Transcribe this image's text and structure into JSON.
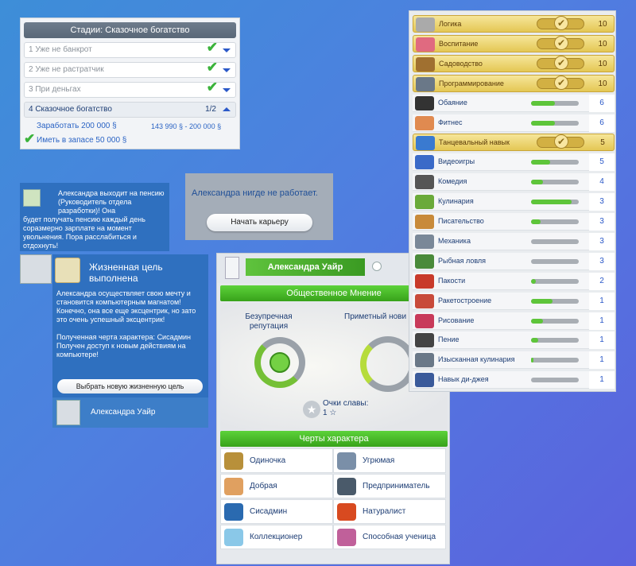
{
  "stages": {
    "header": "Стадии: Сказочное богатство",
    "rows": [
      {
        "label": "1 Уже не банкрот",
        "done": true
      },
      {
        "label": "2 Уже не растратчик",
        "done": true
      },
      {
        "label": "3 При деньгах",
        "done": true
      }
    ],
    "active": {
      "label": "4 Сказочное богатство",
      "count": "1/2"
    },
    "goal1": "Заработать 200 000 §",
    "goal1_progress": "143 990 § - 200 000 §",
    "goal2": "Иметь в запасе 50 000 §"
  },
  "notification": {
    "text1": "Александра выходит на пенсию (Руководитель отдела разработки)! Она",
    "text2": "будет получать пенсию каждый день соразмерно зарплате на момент увольнения. Пора расслабиться и отдохнуть!"
  },
  "career": {
    "status": "Александра нигде не работает.",
    "button": "Начать карьеру"
  },
  "life_goal": {
    "title": "Жизненная цель выполнена",
    "body1": "Александра осуществляет свою мечту и становится компьютерным магнатом! Конечно, она все еще эксцентрик, но зато это очень успешный эксцентрик!",
    "body2": "Полученная черта характера: Сисадмин",
    "body3": "Получен доступ к новым действиям на компьютере!",
    "button": "Выбрать новую жизненную цель",
    "sim_name": "Александра Уайр"
  },
  "sim": {
    "name": "Александра Уайр",
    "reputation_header": "Общественное Мнение",
    "reputation_label": "Безупречная репутация",
    "fame_label": "Приметный нови",
    "fame_points_label": "Очки славы:",
    "fame_points": "1 ☆",
    "traits_header": "Черты характера",
    "traits": [
      {
        "label": "Одиночка",
        "color": "#b8903a"
      },
      {
        "label": "Угрюмая",
        "color": "#7a8fa8"
      },
      {
        "label": "Добрая",
        "color": "#e0a060"
      },
      {
        "label": "Предприниматель",
        "color": "#4a5a6a"
      },
      {
        "label": "Сисадмин",
        "color": "#2a6ab0"
      },
      {
        "label": "Натуралист",
        "color": "#d84a20"
      },
      {
        "label": "Коллекционер",
        "color": "#8ac8e8"
      },
      {
        "label": "Способная ученица",
        "color": "#c0609a"
      }
    ]
  },
  "skills": [
    {
      "name": "Логика",
      "level": "10",
      "max": true,
      "fill": 1,
      "color": "#aaaaaa"
    },
    {
      "name": "Воспитание",
      "level": "10",
      "max": true,
      "fill": 1,
      "color": "#e06a80"
    },
    {
      "name": "Садоводство",
      "level": "10",
      "max": true,
      "fill": 1,
      "color": "#a07030"
    },
    {
      "name": "Программирование",
      "level": "10",
      "max": true,
      "fill": 1,
      "color": "#6a7888"
    },
    {
      "name": "Обаяние",
      "level": "6",
      "max": false,
      "fill": 0.5,
      "color": "#333333"
    },
    {
      "name": "Фитнес",
      "level": "6",
      "max": false,
      "fill": 0.5,
      "color": "#e08a50"
    },
    {
      "name": "Танцевальный навык",
      "level": "5",
      "max": true,
      "fill": 1,
      "color": "#3a7ad0"
    },
    {
      "name": "Видеоигры",
      "level": "5",
      "max": false,
      "fill": 0.4,
      "color": "#3a6ac8"
    },
    {
      "name": "Комедия",
      "level": "4",
      "max": false,
      "fill": 0.25,
      "color": "#555555"
    },
    {
      "name": "Кулинария",
      "level": "3",
      "max": false,
      "fill": 0.85,
      "color": "#6aaa3a"
    },
    {
      "name": "Писательство",
      "level": "3",
      "max": false,
      "fill": 0.2,
      "color": "#c88a3a"
    },
    {
      "name": "Механика",
      "level": "3",
      "max": false,
      "fill": 0,
      "color": "#7a8898"
    },
    {
      "name": "Рыбная ловля",
      "level": "3",
      "max": false,
      "fill": 0,
      "color": "#4a8a3a"
    },
    {
      "name": "Пакости",
      "level": "2",
      "max": false,
      "fill": 0.1,
      "color": "#c83a2a"
    },
    {
      "name": "Ракетостроение",
      "level": "1",
      "max": false,
      "fill": 0.45,
      "color": "#c84a3a"
    },
    {
      "name": "Рисование",
      "level": "1",
      "max": false,
      "fill": 0.25,
      "color": "#c83a5a"
    },
    {
      "name": "Пение",
      "level": "1",
      "max": false,
      "fill": 0.15,
      "color": "#444444"
    },
    {
      "name": "Изысканная кулинария",
      "level": "1",
      "max": false,
      "fill": 0.05,
      "color": "#6a7888"
    },
    {
      "name": "Навык ди-джея",
      "level": "1",
      "max": false,
      "fill": 0,
      "color": "#3a5a9a"
    }
  ]
}
